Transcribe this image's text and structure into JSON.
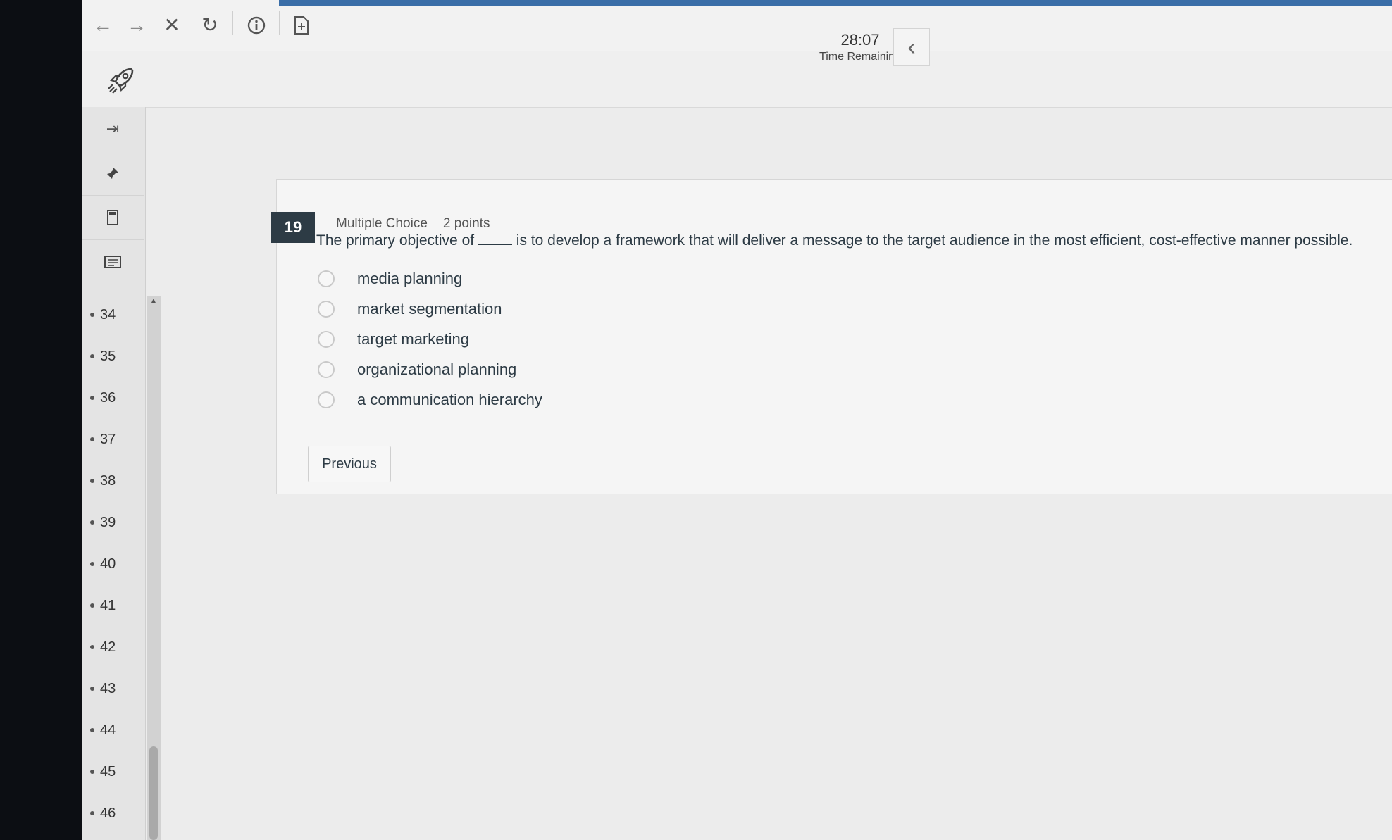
{
  "toolbar": {
    "icons": [
      "back-arrow-icon",
      "forward-arrow-icon",
      "close-icon",
      "reload-icon",
      "info-icon",
      "document-plus-icon"
    ]
  },
  "timer": {
    "time": "28:07",
    "label": "Time Remaining"
  },
  "nav": {
    "icons": [
      "expand-icon",
      "pin-icon",
      "bookmark-icon",
      "notes-icon"
    ],
    "questions": [
      "34",
      "35",
      "36",
      "37",
      "38",
      "39",
      "40",
      "41",
      "42",
      "43",
      "44",
      "45",
      "46"
    ]
  },
  "question": {
    "number": "19",
    "type": "Multiple Choice",
    "points": "2 points",
    "text_before": "The primary objective of",
    "text_after": "is to develop a framework that will deliver a message to the target audience in the most efficient, cost-effective manner possible.",
    "options": [
      "media planning",
      "market segmentation",
      "target marketing",
      "organizational planning",
      "a communication hierarchy"
    ]
  },
  "buttons": {
    "previous": "Previous"
  }
}
